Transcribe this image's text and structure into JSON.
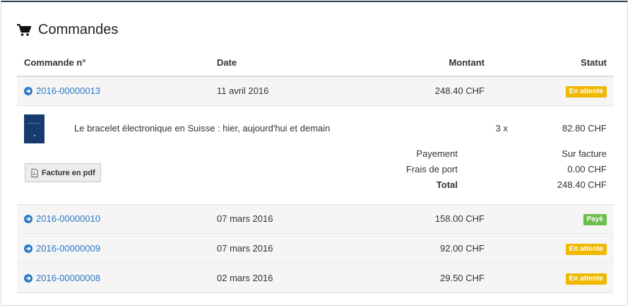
{
  "header": {
    "title": "Commandes"
  },
  "columns": {
    "order_no": "Commande n°",
    "date": "Date",
    "amount": "Montant",
    "status": "Statut"
  },
  "orders": [
    {
      "number": "2016-00000013",
      "date": "11 avril 2016",
      "amount": "248.40 CHF",
      "status": "En attente",
      "status_color": "#f0b800"
    },
    {
      "number": "2016-00000010",
      "date": "07 mars 2016",
      "amount": "158.00 CHF",
      "status": "Payé",
      "status_color": "#6cbf4a"
    },
    {
      "number": "2016-00000009",
      "date": "07 mars 2016",
      "amount": "92.00 CHF",
      "status": "En attente",
      "status_color": "#f0b800"
    },
    {
      "number": "2016-00000008",
      "date": "02 mars 2016",
      "amount": "29.50 CHF",
      "status": "En attente",
      "status_color": "#f0b800"
    }
  ],
  "detail": {
    "item_title": "Le bracelet électronique en Suisse : hier, aujourd'hui et demain",
    "quantity": "3 x",
    "unit_price": "82.80 CHF",
    "payment_label": "Payement",
    "payment_value": "Sur facture",
    "shipping_label": "Frais de port",
    "shipping_value": "0.00 CHF",
    "total_label": "Total",
    "total_value": "248.40 CHF",
    "pdf_button": "Facture en pdf"
  },
  "colors": {
    "link": "#2a7ac8",
    "pending": "#f0b800",
    "paid": "#6cbf4a",
    "header_border": "#2b3a4a"
  },
  "icons": {
    "title_icon": "shopping-cart-icon",
    "row_icon": "arrow-circle-right-icon",
    "pdf_icon": "pdf-file-icon"
  }
}
